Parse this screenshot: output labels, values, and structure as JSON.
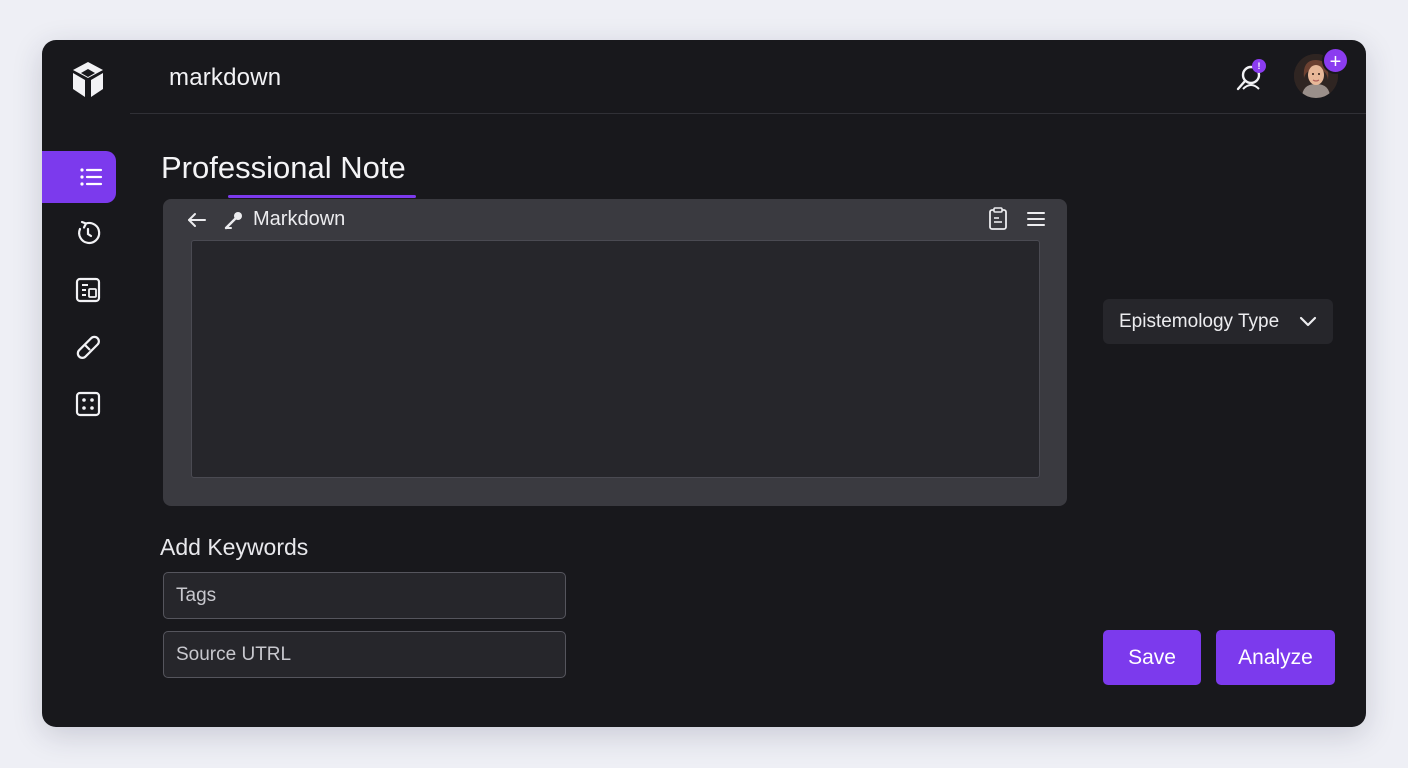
{
  "header": {
    "app_title": "markdown",
    "notification_badge": "!",
    "avatar_action": "+"
  },
  "sidebar": {
    "items": [
      {
        "name": "list",
        "active": true
      },
      {
        "name": "history",
        "active": false
      },
      {
        "name": "document",
        "active": false
      },
      {
        "name": "link",
        "active": false
      },
      {
        "name": "grid",
        "active": false
      }
    ]
  },
  "main": {
    "title": "Professional Note",
    "editor": {
      "mode_label": "Markdown",
      "content": ""
    },
    "epistemology": {
      "selected": "Epistemology Type"
    },
    "keywords": {
      "label": "Add Keywords",
      "tags_placeholder": "Tags",
      "source_placeholder": "Source UTRL"
    },
    "actions": {
      "save_label": "Save",
      "analyze_label": "Analyze"
    }
  },
  "colors": {
    "accent": "#7c3aed",
    "background": "#18181c",
    "panel": "#3a3a40"
  }
}
